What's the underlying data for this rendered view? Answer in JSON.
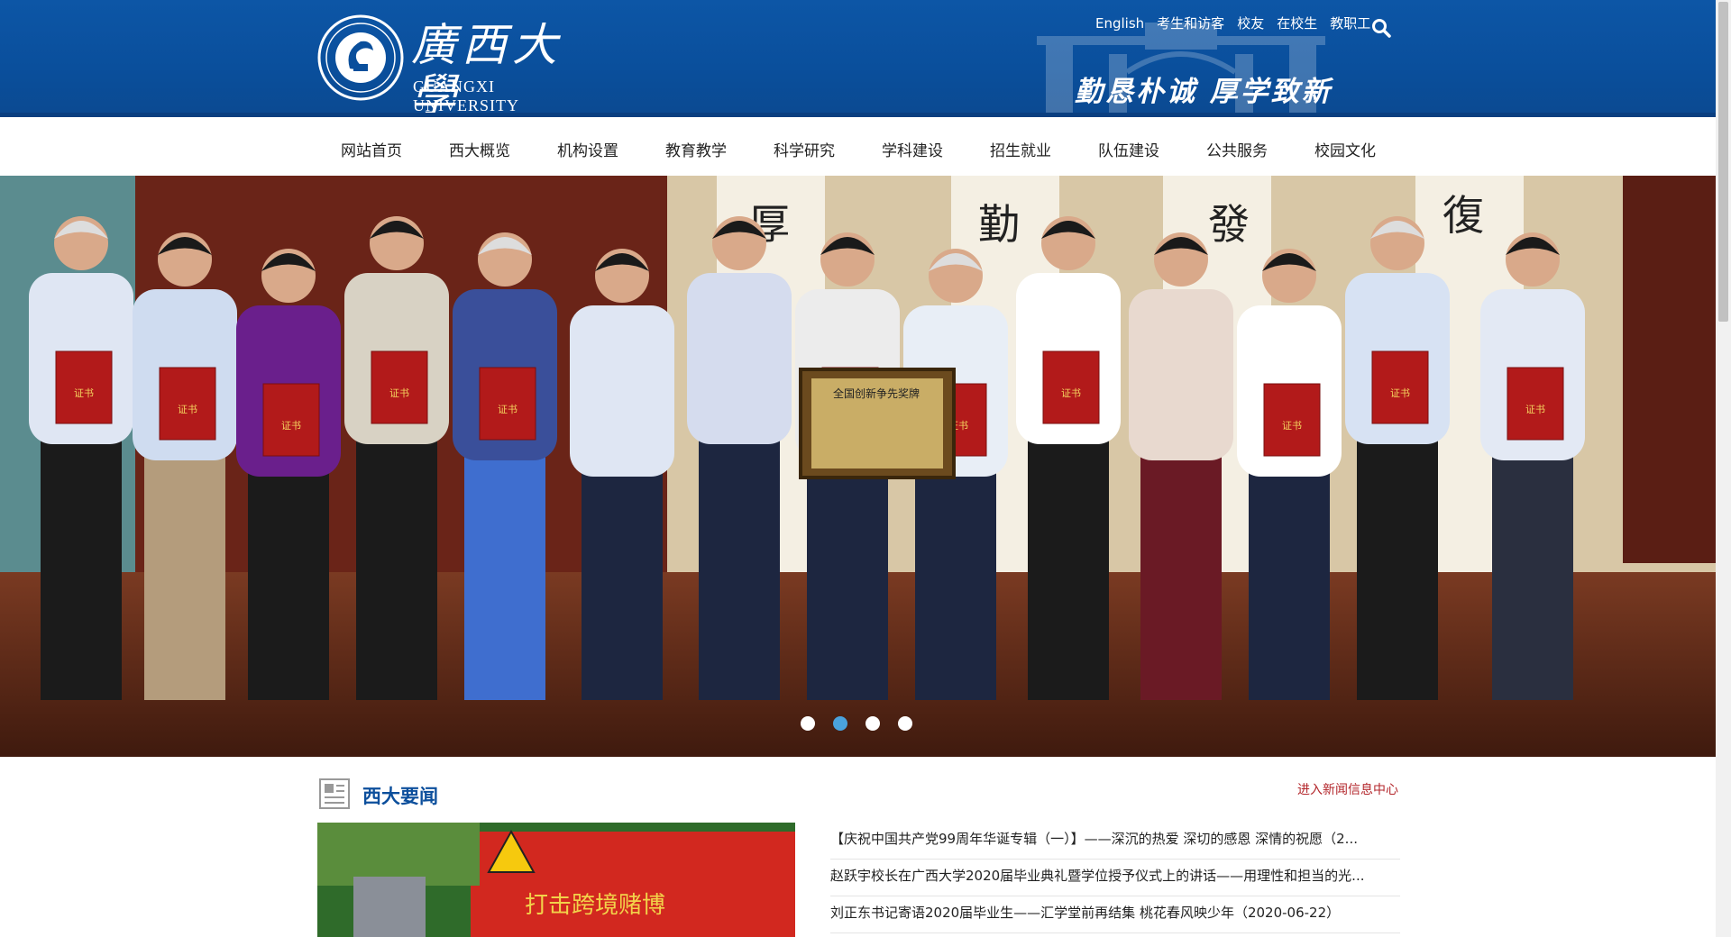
{
  "header": {
    "logo_cn": "廣西大學",
    "logo_en": "GUANGXI UNIVERSITY",
    "motto": "勤恳朴诚 厚学致新",
    "top_links": [
      "English",
      "考生和访客",
      "校友",
      "在校生",
      "教职工"
    ]
  },
  "nav": {
    "items": [
      "网站首页",
      "西大概览",
      "机构设置",
      "教育教学",
      "科学研究",
      "学科建设",
      "招生就业",
      "队伍建设",
      "公共服务",
      "校园文化"
    ]
  },
  "banner": {
    "plaque_text": "全国创新争先奖牌",
    "certificate_text": "证书",
    "dots": 4,
    "active_dot": 2
  },
  "news": {
    "title": "西大要闻",
    "more": "进入新闻信息中心",
    "photo_banner_text": "打击跨境赌博",
    "items": [
      "【庆祝中国共产党99周年华诞专辑（一）】——深沉的热爱 深切的感恩 深情的祝愿（2...",
      "赵跃宇校长在广西大学2020届毕业典礼暨学位授予仪式上的讲话——用理性和担当的光...",
      "刘正东书记寄语2020届毕业生——汇学堂前再结集 桃花春风映少年（2020-06-22）"
    ]
  },
  "colors": {
    "header_blue": "#0a4f9c",
    "news_title": "#0c4f9c",
    "more_link": "#b3262b",
    "dot_active": "#4aa2dc"
  }
}
